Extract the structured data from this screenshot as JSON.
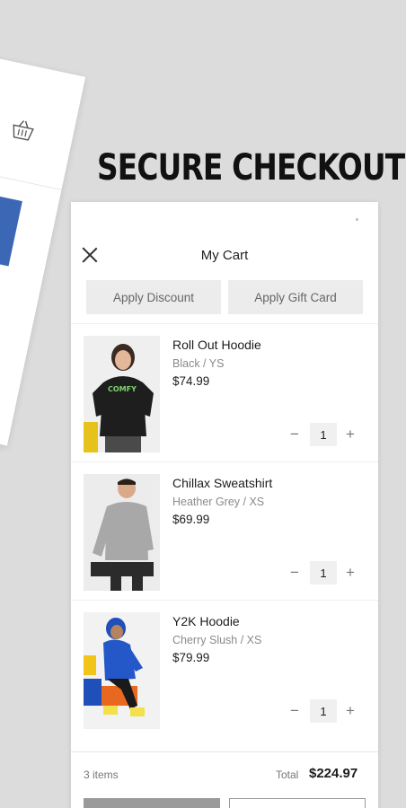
{
  "headline": "SECURE CHECKOUT",
  "cart": {
    "title": "My Cart",
    "apply_discount": "Apply Discount",
    "apply_gift_card": "Apply Gift Card",
    "items": [
      {
        "name": "Roll Out Hoodie",
        "variant": "Black / YS",
        "price": "$74.99",
        "qty": "1",
        "icon": "hoodie-product-image"
      },
      {
        "name": "Chillax Sweatshirt",
        "variant": "Heather Grey / XS",
        "price": "$69.99",
        "qty": "1",
        "icon": "sweatshirt-product-image"
      },
      {
        "name": "Y2K Hoodie",
        "variant": "Cherry Slush / XS",
        "price": "$79.99",
        "qty": "1",
        "icon": "hoodie-product-image"
      }
    ],
    "items_count": "3 items",
    "total_label": "Total",
    "total_value": "$224.97",
    "minus_symbol": "−",
    "plus_symbol": "+"
  },
  "colors": {
    "background": "#dcdcdc",
    "panel": "#ffffff",
    "button_gray": "#ececec",
    "accent_blue": "#3b67b5"
  }
}
